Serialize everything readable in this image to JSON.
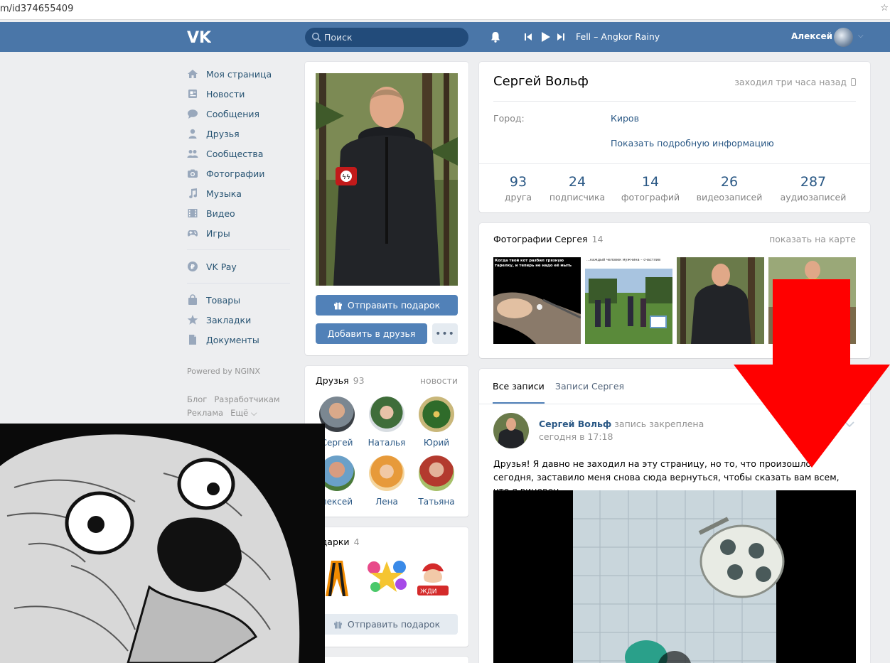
{
  "browser": {
    "url": "m/id374655409",
    "star": "☆"
  },
  "header": {
    "search_placeholder": "Поиск",
    "track": "Fell – Angkor Rainy",
    "user_name": "Алексей"
  },
  "nav": {
    "items": [
      {
        "label": "Моя страница",
        "icon": "home-icon"
      },
      {
        "label": "Новости",
        "icon": "news-icon"
      },
      {
        "label": "Сообщения",
        "icon": "messages-icon"
      },
      {
        "label": "Друзья",
        "icon": "friends-icon"
      },
      {
        "label": "Сообщества",
        "icon": "groups-icon"
      },
      {
        "label": "Фотографии",
        "icon": "camera-icon"
      },
      {
        "label": "Музыка",
        "icon": "music-icon"
      },
      {
        "label": "Видео",
        "icon": "video-icon"
      },
      {
        "label": "Игры",
        "icon": "games-icon"
      }
    ],
    "vkpay": "VK Pay",
    "extra": [
      {
        "label": "Товары",
        "icon": "bag-icon"
      },
      {
        "label": "Закладки",
        "icon": "star-icon"
      },
      {
        "label": "Документы",
        "icon": "document-icon"
      }
    ],
    "powered": "Powered by NGINX",
    "footer": [
      "Блог",
      "Разработчикам",
      "Реклама",
      "Ещё ⌵"
    ]
  },
  "avatar_block": {
    "gift_button": "Отправить подарок",
    "add_friend_button": "Добавить в друзья",
    "more_button": "•••"
  },
  "friends_block": {
    "title": "Друзья",
    "count": "93",
    "news_link": "новости",
    "friends": [
      "Сергей",
      "Наталья",
      "Юрий",
      "лексей",
      "Лена",
      "Татьяна"
    ]
  },
  "gifts_block": {
    "title": "одарки",
    "count": "4",
    "button": "Отправить подарок"
  },
  "profile": {
    "name": "Сергей Вольф",
    "last_seen": "заходил три часа назад",
    "city_label": "Город:",
    "city_value": "Киров",
    "more_info": "Показать подробную информацию",
    "counters": [
      {
        "value": "93",
        "label": "друга"
      },
      {
        "value": "24",
        "label": "подписчика"
      },
      {
        "value": "14",
        "label": "фотографий"
      },
      {
        "value": "26",
        "label": "видеозаписей"
      },
      {
        "value": "287",
        "label": "аудиозаписей"
      }
    ]
  },
  "photos_block": {
    "title": "Фотографии Сергея",
    "count": "14",
    "map_link": "показать на карте",
    "thumb1_caption": "Когда твой кот разбил грязную тарелку, и теперь не надо её мыть",
    "thumb2_caption": "…каждый человек мужчина – счастлив"
  },
  "wall": {
    "tab_all": "Все записи",
    "tab_owner": "Записи Сергея",
    "post_author": "Сергей Вольф",
    "post_pinned": "запись закреплена",
    "post_time": "сегодня в 17:18",
    "post_text_main": "Друзья! Я давно не заходил на эту страницу, но то, что произошло сегодня, заставило меня снова сюда вернуться, чтобы сказать вам всем, что ",
    "post_text_highlight": "я виновен",
    "post_text_end": "."
  },
  "colors": {
    "header_bg": "#4a76a8",
    "link": "#2a5885",
    "button": "#5181b8",
    "arrow": "#ff0000",
    "page_bg": "#edeef0"
  }
}
